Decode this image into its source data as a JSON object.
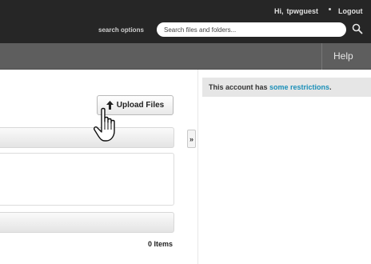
{
  "header": {
    "greeting": "Hi,",
    "username": "tpwguest",
    "logout_label": "Logout",
    "search_options_label": "search options",
    "search_placeholder": "Search files and folders...",
    "search_icon": "magnifier-icon"
  },
  "subnav": {
    "help_label": "Help"
  },
  "main": {
    "upload_label": "Upload Files",
    "upload_icon": "arrow-up-icon",
    "item_count": "0 Items"
  },
  "sidebar": {
    "toggle_label": "»",
    "notice_text": "This account has ",
    "notice_link": "some restrictions",
    "notice_suffix": "."
  },
  "colors": {
    "topbar": "#262626",
    "subbar": "#5e5e5e",
    "link": "#1a8fb8"
  }
}
